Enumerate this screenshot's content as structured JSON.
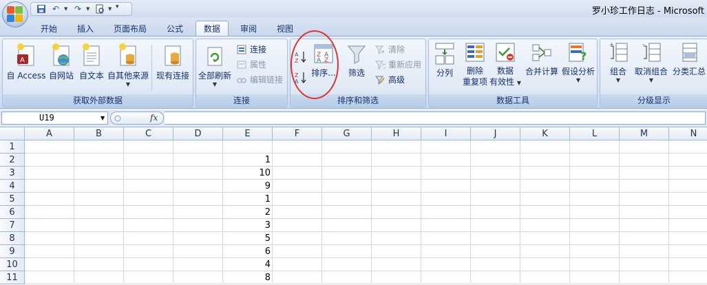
{
  "window": {
    "title": "罗小珍工作日志 - Microsoft"
  },
  "tabs": [
    {
      "label": "开始",
      "active": false
    },
    {
      "label": "插入",
      "active": false
    },
    {
      "label": "页面布局",
      "active": false
    },
    {
      "label": "公式",
      "active": false
    },
    {
      "label": "数据",
      "active": true
    },
    {
      "label": "审阅",
      "active": false
    },
    {
      "label": "视图",
      "active": false
    }
  ],
  "ribbon": {
    "external": {
      "label": "获取外部数据",
      "access": "自 Access",
      "web": "自网站",
      "text": "自文本",
      "other": "自其他来源",
      "existing": "现有连接"
    },
    "connections": {
      "label": "连接",
      "refresh_all": "全部刷新",
      "connections": "连接",
      "properties": "属性",
      "edit_links": "编辑链接"
    },
    "sort_filter": {
      "label": "排序和筛选",
      "sort": "排序...",
      "filter": "筛选",
      "clear": "清除",
      "reapply": "重新应用",
      "advanced": "高级"
    },
    "data_tools": {
      "label": "数据工具",
      "text_to_columns": "分列",
      "remove_dup_1": "删除",
      "remove_dup_2": "重复项",
      "validation_1": "数据",
      "validation_2": "有效性",
      "consolidate": "合并计算",
      "what_if": "假设分析"
    },
    "outline": {
      "label": "分级显示",
      "group": "组合",
      "ungroup": "取消组合",
      "subtotal": "分类汇总"
    }
  },
  "formula_bar": {
    "name_box": "U19",
    "fx": "fx",
    "formula": ""
  },
  "grid": {
    "columns": [
      "A",
      "B",
      "C",
      "D",
      "E",
      "F",
      "G",
      "H",
      "I",
      "J",
      "K",
      "L",
      "M",
      "N"
    ],
    "rows": [
      "1",
      "2",
      "3",
      "4",
      "5",
      "6",
      "7",
      "8",
      "9",
      "10",
      "11"
    ],
    "column_e_values": [
      "",
      "1",
      "10",
      "9",
      "1",
      "2",
      "3",
      "5",
      "6",
      "4",
      "8"
    ]
  },
  "colors": {
    "annotation_circle": "#e03030",
    "tab_text": "#15306d"
  }
}
